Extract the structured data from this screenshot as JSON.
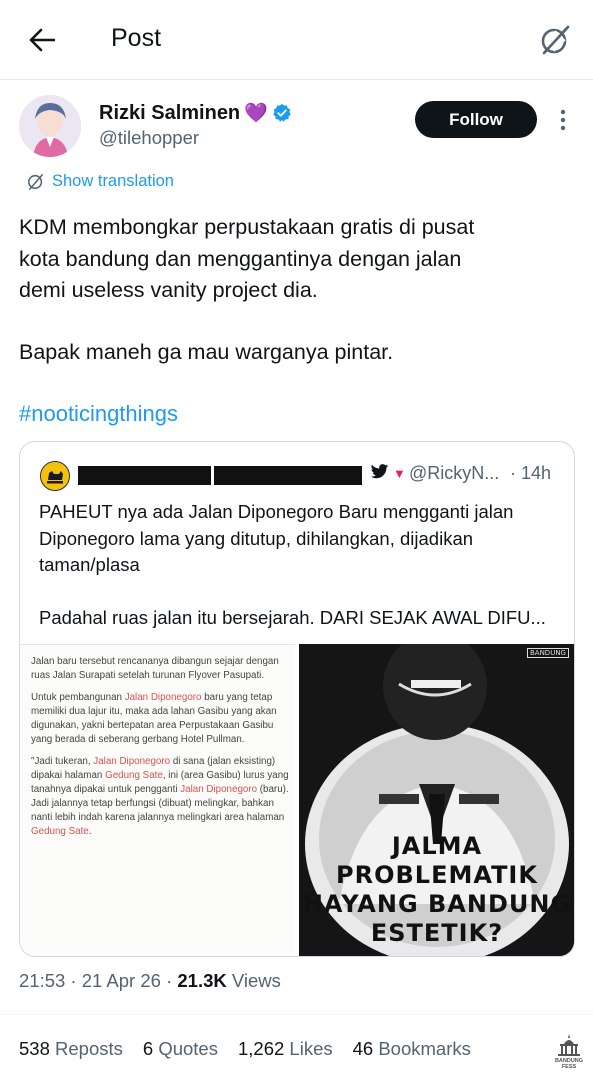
{
  "header": {
    "title": "Post"
  },
  "author": {
    "display_name": "Rizki Salminen",
    "name_emoji": "💜",
    "handle": "@tilehopper",
    "follow_label": "Follow"
  },
  "translation": {
    "label": "Show translation"
  },
  "tweet": {
    "lines": [
      "KDM membongkar perpustakaan gratis di pusat",
      "kota bandung dan menggantinya dengan jalan",
      "demi useless vanity project dia."
    ],
    "line2": "Bapak maneh ga mau warganya pintar.",
    "hashtag": "#nooticingthings"
  },
  "quote": {
    "handle": "@RickyN...",
    "time": "· 14h",
    "lines": [
      "PAHEUT nya ada Jalan Diponegoro Baru  mengganti jalan",
      "Diponegoro lama yang ditutup, dihilangkan,  dijadikan",
      "taman/plasa"
    ],
    "line2": "Padahal ruas jalan itu bersejarah. DARI SEJAK AWAL DIFU...",
    "article": {
      "p1": "Jalan baru tersebut rencananya dibangun sejajar dengan ruas Jalan Surapati setelah turunan Flyover Pasupati.",
      "p2a": "Untuk pembangunan ",
      "p2b": "Jalan Diponegoro",
      "p2c": " baru yang tetap memiliki dua lajur itu, maka ada lahan Gasibu yang akan digunakan, yakni bertepatan area Perpustakaan Gasibu yang berada di seberang gerbang Hotel Pullman.",
      "p3a": "\"Jadi tukeran, ",
      "p3b": "Jalan Diponegoro",
      "p3c": " di sana (jalan eksisting) dipakai halaman ",
      "p3d": "Gedung Sate",
      "p3e": ", ini (area Gasibu) lurus yang tanahnya dipakai untuk pengganti ",
      "p3f": "Jalan Diponegoro",
      "p3g": " (baru). Jadi jalannya tetap berfungsi (dibuat) melingkar, bahkan nanti lebih indah karena jalannya melingkari area halaman ",
      "p3h": "Gedung Sate",
      "p3i": "."
    },
    "poster": {
      "line1": "JALMA PROBLEMATIK",
      "line2": "HAYANG BANDUNG",
      "line3": "ESTETIK?"
    }
  },
  "meta": {
    "time_date": "21:53 · 21 Apr 26 · ",
    "views_count": "21.3K",
    "views_label": " Views"
  },
  "stats": {
    "reposts_count": "538",
    "reposts_label": "Reposts",
    "quotes_count": "6",
    "quotes_label": "Quotes",
    "likes_count": "1,262",
    "likes_label": "Likes",
    "bookmarks_count": "46",
    "bookmarks_label": "Bookmarks"
  },
  "watermark": {
    "text": "BANDUNG FESS"
  },
  "colors": {
    "accent": "#1d9bf0",
    "text": "#0f1419",
    "secondary": "#536471",
    "follow_bg": "#0f1419",
    "verified": "#1d9bf0",
    "heart_emoji": "#9b4dca"
  },
  "icons": [
    "back-arrow-icon",
    "grok-icon",
    "verified-badge-icon",
    "more-vertical-icon",
    "translate-icon",
    "twitter-bird-icon",
    "down-arrow-icon",
    "watermark-building-icon"
  ]
}
